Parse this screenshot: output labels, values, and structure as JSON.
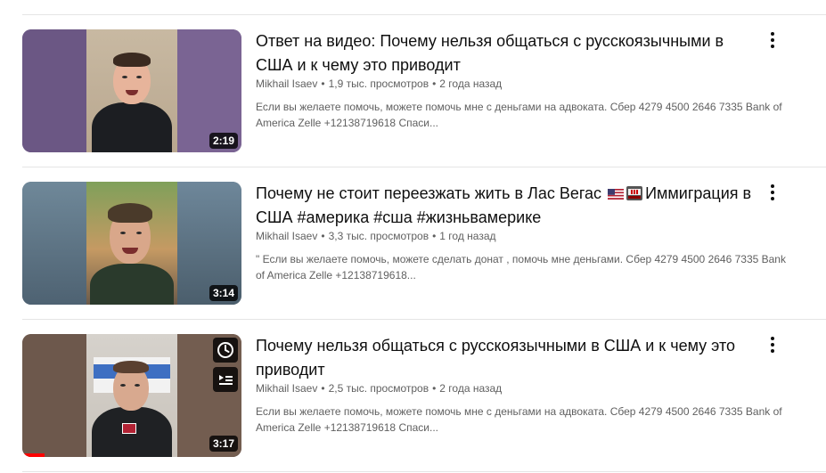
{
  "videos": [
    {
      "title": "Ответ на видео: Почему нельзя общаться с русскоязычными в США и к чему это приводит",
      "channel": "Mikhail Isaev",
      "views": "1,9 тыс. просмотров",
      "age": "2 года назад",
      "description": "Если вы желаете помочь, можете помочь мне с деньгами на адвоката. Сбер 4279 4500 2646 7335 Bank of America Zelle +12138719618 Спаси...",
      "duration": "2:19"
    },
    {
      "title_part1": "Почему не стоит переезжать жить в Лас Вегас",
      "title_part2": "Иммиграция в США #америка #сша #жизньвамерике",
      "channel": "Mikhail Isaev",
      "views": "3,3 тыс. просмотров",
      "age": "1 год назад",
      "description": "\" Если вы желаете помочь, можете сделать донат , помочь мне деньгами. Сбер 4279 4500 2646 7335 Bank of America Zelle +12138719618...",
      "duration": "3:14"
    },
    {
      "title": "Почему нельзя общаться с русскоязычными в США и к чему это приводит",
      "channel": "Mikhail Isaev",
      "views": "2,5 тыс. просмотров",
      "age": "2 года назад",
      "description": "Если вы желаете помочь, можете помочь мне с деньгами на адвоката. Сбер 4279 4500 2646 7335 Bank of America Zelle +12138719618 Спаси...",
      "duration": "3:17",
      "watch_progress": 0.1
    }
  ],
  "separator": "•",
  "icons": {
    "more": "kebab-vertical-icon",
    "watch_later": "clock-icon",
    "add_to_queue": "playlist-add-icon"
  },
  "colors": {
    "title": "#0f0f0f",
    "meta": "#606060",
    "progress": "#ff0000"
  }
}
